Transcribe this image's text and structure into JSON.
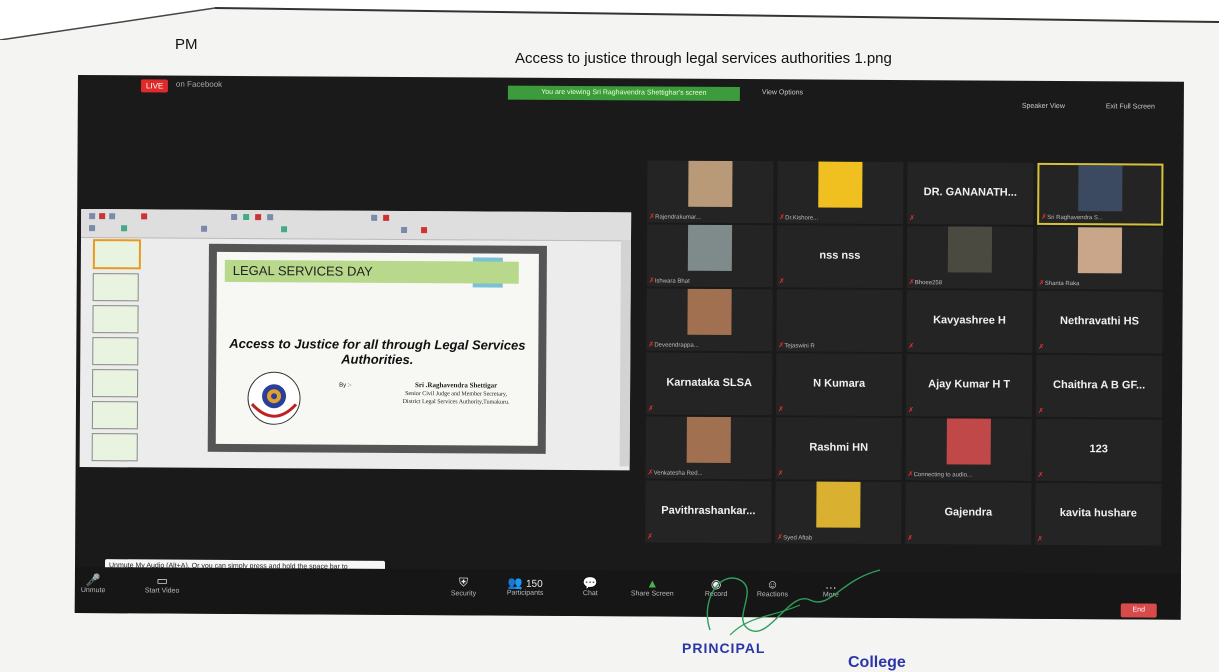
{
  "header": {
    "time_fragment": "PM",
    "document_title": "Access to justice through legal services authorities 1.png"
  },
  "zoom": {
    "live_badge": "LIVE",
    "live_target": "on Facebook",
    "viewing_banner": "You are viewing Sri Raghavendra Shettighar's screen",
    "view_options": "View Options",
    "speaker_view": "Speaker View",
    "exit_full_screen": "Exit Full Screen"
  },
  "slide": {
    "heading": "LEGAL SERVICES DAY",
    "main_text": "Access to Justice for all through Legal Services Authorities.",
    "by_label": "By :-",
    "presenter_name": "Sri .Raghavendra Shettigar",
    "presenter_role": "Senior Civil Judge and Member Secretary,",
    "presenter_org": "District Legal Services Authority,Tumakuru.",
    "emblem_text": "ACCESS TO JUSTICE FOR ALL",
    "thumbnail_count": 7
  },
  "participants": [
    {
      "name": "",
      "caption": "Rajendrakumar...",
      "photo": "person-cap"
    },
    {
      "name": "",
      "caption": "Dr.Kishore...",
      "photo": "college-logo"
    },
    {
      "name": "DR. GANANATH...",
      "caption": "",
      "photo": ""
    },
    {
      "name": "",
      "caption": "Sri Raghavendra S...",
      "photo": "judge",
      "highlighted": true
    },
    {
      "name": "",
      "caption": "Ishwara Bhat",
      "photo": "person"
    },
    {
      "name": "nss nss",
      "caption": "",
      "photo": ""
    },
    {
      "name": "",
      "caption": "Bhoee258",
      "photo": "room"
    },
    {
      "name": "",
      "caption": "Shanta Raka",
      "photo": "woman"
    },
    {
      "name": "",
      "caption": "Deveendrappa...",
      "photo": "man"
    },
    {
      "name": "",
      "caption": "Tejaswini R",
      "photo": ""
    },
    {
      "name": "Kavyashree H",
      "caption": "",
      "photo": ""
    },
    {
      "name": "Nethravathi HS",
      "caption": "",
      "photo": ""
    },
    {
      "name": "Karnataka SLSA",
      "caption": "",
      "photo": ""
    },
    {
      "name": "N Kumara",
      "caption": "",
      "photo": ""
    },
    {
      "name": "Ajay Kumar H T",
      "caption": "",
      "photo": ""
    },
    {
      "name": "Chaithra A B GF...",
      "caption": "",
      "photo": ""
    },
    {
      "name": "",
      "caption": "Venkatesha Red...",
      "photo": "man"
    },
    {
      "name": "Rashmi HN",
      "caption": "",
      "photo": ""
    },
    {
      "name": "",
      "caption": "Connecting to audio...",
      "photo": "group"
    },
    {
      "name": "123",
      "caption": "",
      "photo": ""
    },
    {
      "name": "Pavithrashankar...",
      "caption": "",
      "photo": ""
    },
    {
      "name": "",
      "caption": "Syed Aftab",
      "photo": "man-yellow"
    },
    {
      "name": "Gajendra",
      "caption": "",
      "photo": ""
    },
    {
      "name": "kavita hushare",
      "caption": "",
      "photo": ""
    }
  ],
  "toolbar": {
    "unmute": "Unmute",
    "start_video": "Start Video",
    "security": "Security",
    "participants": "Participants",
    "participants_count": "150",
    "chat": "Chat",
    "share_screen": "Share Screen",
    "record": "Record",
    "reactions": "Reactions",
    "more": "More",
    "end": "End",
    "tooltip": "Unmute My Audio (Alt+A). Or you can simply press and hold the space bar to temporarily unmute."
  },
  "stamp": {
    "principal": "PRINCIPAL",
    "college": "College"
  },
  "colors": {
    "live": "#e02a2a",
    "banner": "#3c9c3c",
    "end": "#d94a4a",
    "stamp": "#2a36a8"
  }
}
